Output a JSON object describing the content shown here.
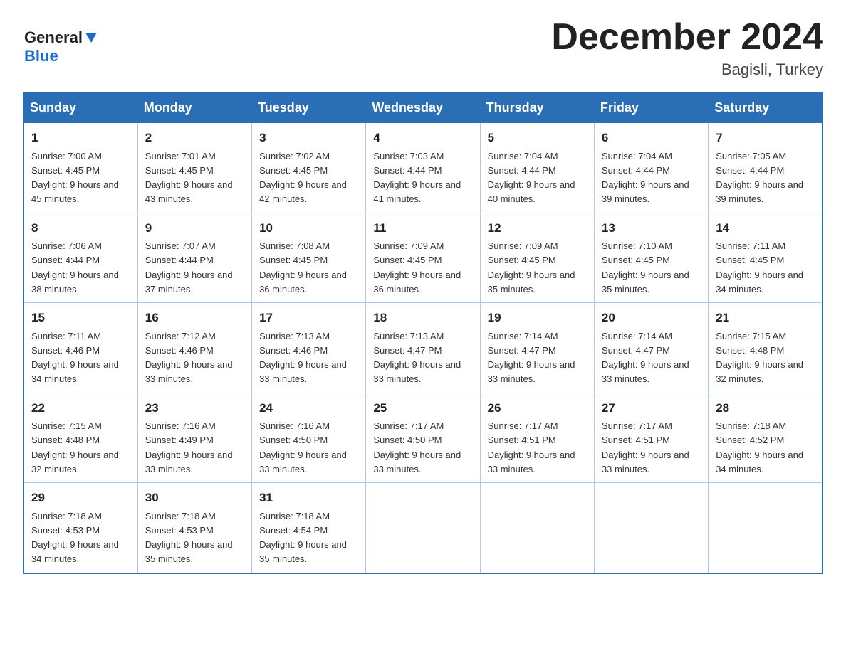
{
  "header": {
    "logo_general": "General",
    "logo_blue": "Blue",
    "month_title": "December 2024",
    "location": "Bagisli, Turkey"
  },
  "days_of_week": [
    "Sunday",
    "Monday",
    "Tuesday",
    "Wednesday",
    "Thursday",
    "Friday",
    "Saturday"
  ],
  "weeks": [
    [
      {
        "day": "1",
        "sunrise": "7:00 AM",
        "sunset": "4:45 PM",
        "daylight": "9 hours and 45 minutes."
      },
      {
        "day": "2",
        "sunrise": "7:01 AM",
        "sunset": "4:45 PM",
        "daylight": "9 hours and 43 minutes."
      },
      {
        "day": "3",
        "sunrise": "7:02 AM",
        "sunset": "4:45 PM",
        "daylight": "9 hours and 42 minutes."
      },
      {
        "day": "4",
        "sunrise": "7:03 AM",
        "sunset": "4:44 PM",
        "daylight": "9 hours and 41 minutes."
      },
      {
        "day": "5",
        "sunrise": "7:04 AM",
        "sunset": "4:44 PM",
        "daylight": "9 hours and 40 minutes."
      },
      {
        "day": "6",
        "sunrise": "7:04 AM",
        "sunset": "4:44 PM",
        "daylight": "9 hours and 39 minutes."
      },
      {
        "day": "7",
        "sunrise": "7:05 AM",
        "sunset": "4:44 PM",
        "daylight": "9 hours and 39 minutes."
      }
    ],
    [
      {
        "day": "8",
        "sunrise": "7:06 AM",
        "sunset": "4:44 PM",
        "daylight": "9 hours and 38 minutes."
      },
      {
        "day": "9",
        "sunrise": "7:07 AM",
        "sunset": "4:44 PM",
        "daylight": "9 hours and 37 minutes."
      },
      {
        "day": "10",
        "sunrise": "7:08 AM",
        "sunset": "4:45 PM",
        "daylight": "9 hours and 36 minutes."
      },
      {
        "day": "11",
        "sunrise": "7:09 AM",
        "sunset": "4:45 PM",
        "daylight": "9 hours and 36 minutes."
      },
      {
        "day": "12",
        "sunrise": "7:09 AM",
        "sunset": "4:45 PM",
        "daylight": "9 hours and 35 minutes."
      },
      {
        "day": "13",
        "sunrise": "7:10 AM",
        "sunset": "4:45 PM",
        "daylight": "9 hours and 35 minutes."
      },
      {
        "day": "14",
        "sunrise": "7:11 AM",
        "sunset": "4:45 PM",
        "daylight": "9 hours and 34 minutes."
      }
    ],
    [
      {
        "day": "15",
        "sunrise": "7:11 AM",
        "sunset": "4:46 PM",
        "daylight": "9 hours and 34 minutes."
      },
      {
        "day": "16",
        "sunrise": "7:12 AM",
        "sunset": "4:46 PM",
        "daylight": "9 hours and 33 minutes."
      },
      {
        "day": "17",
        "sunrise": "7:13 AM",
        "sunset": "4:46 PM",
        "daylight": "9 hours and 33 minutes."
      },
      {
        "day": "18",
        "sunrise": "7:13 AM",
        "sunset": "4:47 PM",
        "daylight": "9 hours and 33 minutes."
      },
      {
        "day": "19",
        "sunrise": "7:14 AM",
        "sunset": "4:47 PM",
        "daylight": "9 hours and 33 minutes."
      },
      {
        "day": "20",
        "sunrise": "7:14 AM",
        "sunset": "4:47 PM",
        "daylight": "9 hours and 33 minutes."
      },
      {
        "day": "21",
        "sunrise": "7:15 AM",
        "sunset": "4:48 PM",
        "daylight": "9 hours and 32 minutes."
      }
    ],
    [
      {
        "day": "22",
        "sunrise": "7:15 AM",
        "sunset": "4:48 PM",
        "daylight": "9 hours and 32 minutes."
      },
      {
        "day": "23",
        "sunrise": "7:16 AM",
        "sunset": "4:49 PM",
        "daylight": "9 hours and 33 minutes."
      },
      {
        "day": "24",
        "sunrise": "7:16 AM",
        "sunset": "4:50 PM",
        "daylight": "9 hours and 33 minutes."
      },
      {
        "day": "25",
        "sunrise": "7:17 AM",
        "sunset": "4:50 PM",
        "daylight": "9 hours and 33 minutes."
      },
      {
        "day": "26",
        "sunrise": "7:17 AM",
        "sunset": "4:51 PM",
        "daylight": "9 hours and 33 minutes."
      },
      {
        "day": "27",
        "sunrise": "7:17 AM",
        "sunset": "4:51 PM",
        "daylight": "9 hours and 33 minutes."
      },
      {
        "day": "28",
        "sunrise": "7:18 AM",
        "sunset": "4:52 PM",
        "daylight": "9 hours and 34 minutes."
      }
    ],
    [
      {
        "day": "29",
        "sunrise": "7:18 AM",
        "sunset": "4:53 PM",
        "daylight": "9 hours and 34 minutes."
      },
      {
        "day": "30",
        "sunrise": "7:18 AM",
        "sunset": "4:53 PM",
        "daylight": "9 hours and 35 minutes."
      },
      {
        "day": "31",
        "sunrise": "7:18 AM",
        "sunset": "4:54 PM",
        "daylight": "9 hours and 35 minutes."
      },
      null,
      null,
      null,
      null
    ]
  ]
}
